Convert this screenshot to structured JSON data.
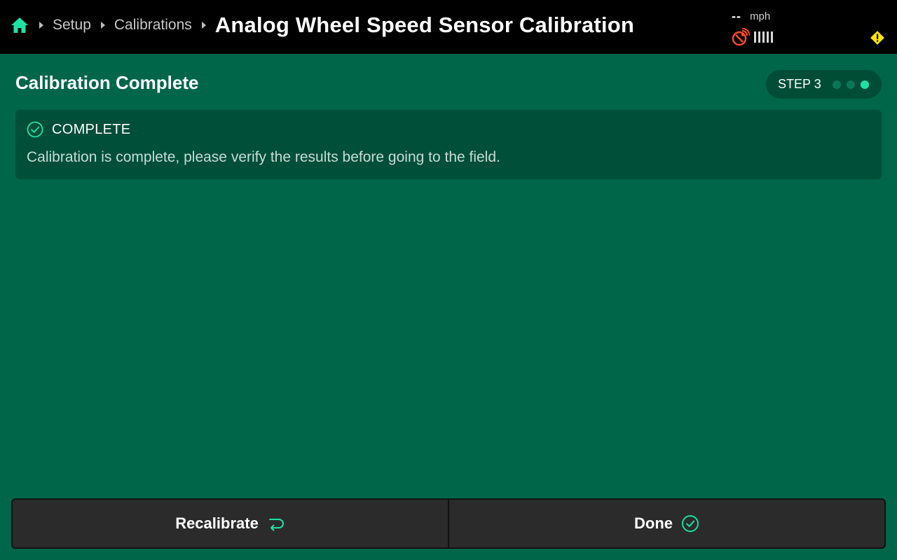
{
  "colors": {
    "background": "#00664a",
    "topbar": "#000000",
    "accent": "#1de2a5",
    "panel": "#004f39",
    "button": "#2b2b2b",
    "gps_alert": "#ff4a2a",
    "warning": "#ffe500"
  },
  "header": {
    "home_icon": "home-icon",
    "breadcrumbs": [
      {
        "label": "Setup"
      },
      {
        "label": "Calibrations"
      }
    ],
    "title": "Analog Wheel Speed Sensor Calibration"
  },
  "status": {
    "speed_value": "--",
    "speed_unit": "mph",
    "gps_icon": "gps-no-signal-icon",
    "signal_bars": 5,
    "warning_icon": "warning-icon"
  },
  "page": {
    "title": "Calibration Complete",
    "step": {
      "label": "STEP 3",
      "current": 3,
      "total": 3
    }
  },
  "notice": {
    "icon": "check-circle-icon",
    "title": "COMPLETE",
    "message": "Calibration is complete, please verify the results before going to the field."
  },
  "actions": {
    "recalibrate": {
      "label": "Recalibrate",
      "icon": "return-arrow-icon"
    },
    "done": {
      "label": "Done",
      "icon": "check-circle-icon"
    }
  }
}
